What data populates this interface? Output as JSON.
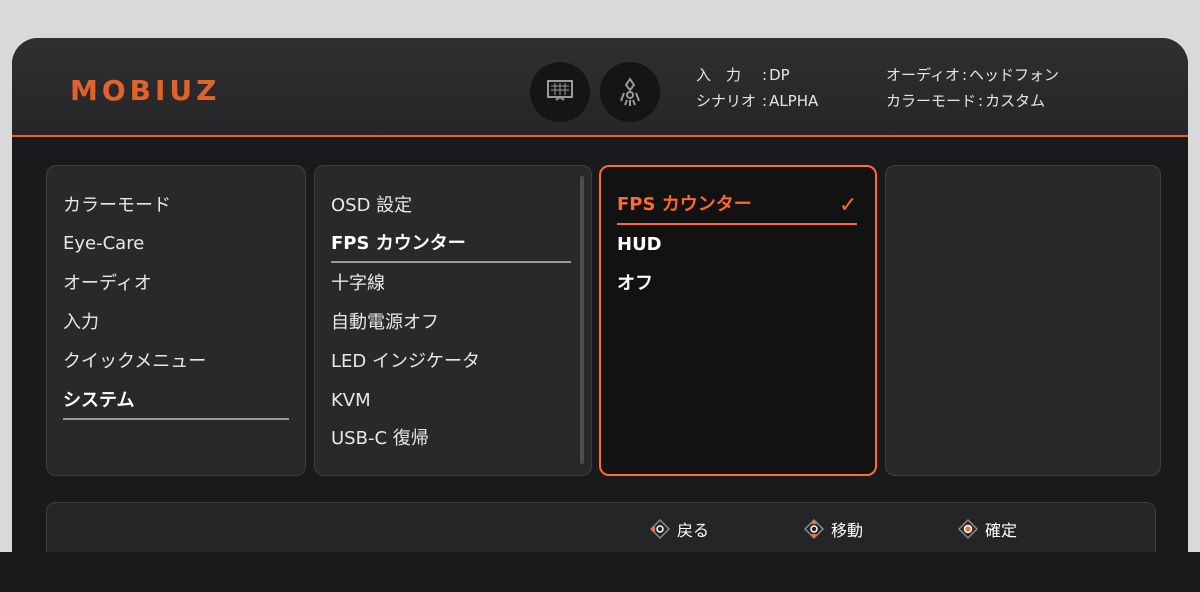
{
  "header": {
    "logo_text": "MOBIUZ",
    "icons": [
      "display-settings-icon",
      "game-mode-icon"
    ],
    "info": {
      "input_label": "入　力",
      "input_value": "DP",
      "scenario_label": "シナリオ",
      "scenario_value": "ALPHA",
      "audio_label": "オーディオ",
      "audio_value": "ヘッドフォン",
      "color_mode_label": "カラーモード",
      "color_mode_value": "カスタム",
      "separator": ":"
    }
  },
  "menu": {
    "level1": [
      "カラーモード",
      "Eye-Care",
      "オーディオ",
      "入力",
      "クイックメニュー",
      "システム"
    ],
    "level1_active": "システム",
    "level2": [
      "OSD 設定",
      "FPS カウンター",
      "十字線",
      "自動電源オフ",
      "LED インジケータ",
      "KVM",
      "USB-C 復帰"
    ],
    "level2_active": "FPS カウンター",
    "level3": [
      "FPS カウンター",
      "HUD",
      "オフ"
    ],
    "level3_selected": "FPS カウンター"
  },
  "footer": {
    "back_label": "戻る",
    "move_label": "移動",
    "ok_label": "確定"
  },
  "colors": {
    "accent": "#ff6a2e",
    "panel": "#1a1a1c",
    "text": "#e8e8e8"
  }
}
